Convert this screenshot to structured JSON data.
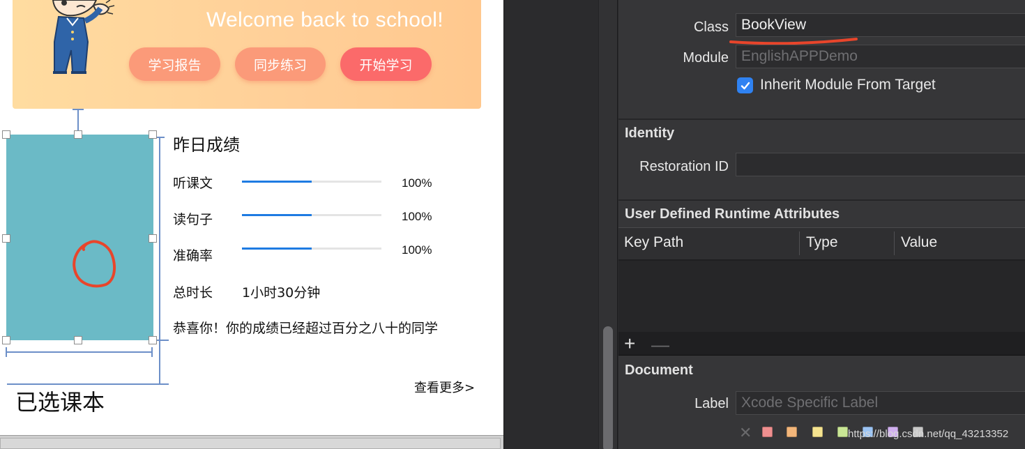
{
  "canvas": {
    "banner": {
      "welcome_text": "Welcome back to school!",
      "buttons": {
        "report": "学习报告",
        "practice": "同步练习",
        "start": "开始学习"
      }
    },
    "score": {
      "title": "昨日成绩",
      "rows": [
        {
          "label": "听课文",
          "percent_text": "100%",
          "progress": 0.5
        },
        {
          "label": "读句子",
          "percent_text": "100%",
          "progress": 0.5
        },
        {
          "label": "准确率",
          "percent_text": "100%",
          "progress": 0.5
        }
      ],
      "duration_label": "总时长",
      "duration_value": "1小时30分钟",
      "congrats": "恭喜你！你的成绩已经超过百分之八十的同学",
      "more_link": "查看更多>"
    },
    "selected_books_title": "已选课本"
  },
  "inspector": {
    "custom_class": {
      "class_label": "Class",
      "class_value": "BookView",
      "module_label": "Module",
      "module_placeholder": "EnglishAPPDemo",
      "inherit_label": "Inherit Module From Target",
      "inherit_checked": true
    },
    "identity": {
      "title": "Identity",
      "restoration_label": "Restoration ID",
      "restoration_value": ""
    },
    "runtime_attributes": {
      "title": "User Defined Runtime Attributes",
      "columns": [
        "Key Path",
        "Type",
        "Value"
      ]
    },
    "document": {
      "title": "Document",
      "label_label": "Label",
      "label_placeholder": "Xcode Specific Label",
      "swatch_colors": [
        "#ef8f8f",
        "#f3b67a",
        "#f5e38f",
        "#c9e695",
        "#9cc4f3",
        "#d1b0ef",
        "#c9c9c9"
      ]
    }
  },
  "watermark": "https://blog.csdn.net/qq_43213352",
  "colors": {
    "accent_blue": "#2f82f2",
    "constraint": "#6c8fc8",
    "bookview_fill": "#6bbac6",
    "progress_fill": "#1e7be2"
  }
}
